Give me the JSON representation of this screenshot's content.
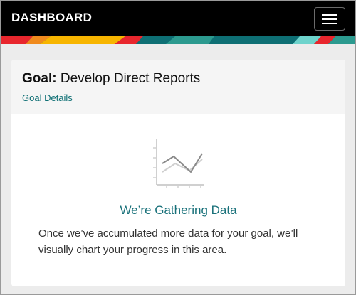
{
  "header": {
    "title": "DASHBOARD",
    "menu_icon": "hamburger-menu-icon",
    "stripe_colors": [
      "#e8262d",
      "#f7b500",
      "#f08a1d",
      "#2c9a8f",
      "#0e6f74",
      "#6ed3cc"
    ]
  },
  "goal": {
    "label": "Goal:",
    "name": "Develop Direct Reports",
    "details_link": "Goal Details"
  },
  "empty_state": {
    "icon": "line-chart-icon",
    "title": "We’re Gathering Data",
    "message": "Once we’ve accumulated more data for your goal, we’ll visually chart your progress in this area."
  },
  "colors": {
    "accent": "#0e6f74",
    "topbar": "#000000"
  }
}
